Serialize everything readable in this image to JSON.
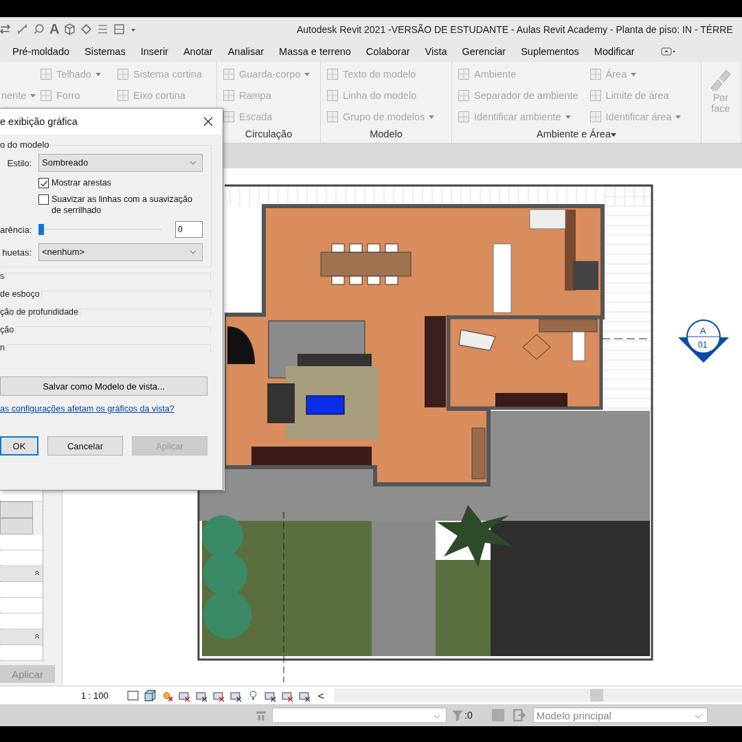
{
  "window": {
    "title": "Autodesk Revit 2021 -VERSÃO DE ESTUDANTE - Aulas Revit Academy - Planta de piso: IN - TÉRRE",
    "quick_access_letter": "A"
  },
  "tabs": [
    "Pré-moldado",
    "Sistemas",
    "Inserir",
    "Anotar",
    "Analisar",
    "Massa e terreno",
    "Colaborar",
    "Vista",
    "Gerenciar",
    "Suplementos",
    "Modificar"
  ],
  "ribbon": [
    {
      "columns": [
        [
          {
            "label": "nente",
            "kind": "cut",
            "dropdown": true
          }
        ],
        [
          {
            "label": "Telhado",
            "kind": "small",
            "dropdown": true
          },
          {
            "label": "Forro",
            "kind": "small",
            "dropdown": false
          }
        ],
        [
          {
            "label": "Sistema cortina",
            "kind": "small",
            "dropdown": false
          },
          {
            "label": "Eixo cortina",
            "kind": "small",
            "dropdown": false
          }
        ]
      ]
    },
    {
      "title": "Circulação",
      "title_dropdown": false,
      "columns": [
        [
          {
            "label": "Guarda-corpo",
            "kind": "small",
            "dropdown": true
          },
          {
            "label": "Rampa",
            "kind": "small",
            "dropdown": false
          },
          {
            "label": "Escada",
            "kind": "small",
            "dropdown": false
          }
        ]
      ]
    },
    {
      "title": "Modelo",
      "title_dropdown": false,
      "columns": [
        [
          {
            "label": "Texto do modelo",
            "kind": "small",
            "dropdown": false
          },
          {
            "label": "Linha do modelo",
            "kind": "small",
            "dropdown": false
          },
          {
            "label": "Grupo de modelos",
            "kind": "small",
            "dropdown": true
          }
        ]
      ]
    },
    {
      "title": "Ambiente e Área",
      "title_dropdown": true,
      "columns": [
        [
          {
            "label": "Ambiente",
            "kind": "small",
            "dropdown": false
          },
          {
            "label": "Separador de ambiente",
            "kind": "small",
            "dropdown": false
          },
          {
            "label": "Identificar ambiente",
            "kind": "small",
            "dropdown": true
          }
        ],
        [
          {
            "label": "Área",
            "kind": "small",
            "dropdown": true
          },
          {
            "label": "Limite de área",
            "kind": "small",
            "dropdown": false
          },
          {
            "label": "Identificar área",
            "kind": "small",
            "dropdown": true
          }
        ]
      ]
    },
    {
      "columns": [
        [
          {
            "label": "Por face",
            "kind": "large",
            "dropdown": false
          }
        ]
      ]
    }
  ],
  "dialog": {
    "title": "e exibição gráfica",
    "group_title": "o do modelo",
    "style": {
      "label": "Estilo:",
      "value": "Sombreado"
    },
    "checkboxes": [
      {
        "label": "Mostrar arestas",
        "checked": true
      },
      {
        "label": "Suavizar as linhas com a suavização de serrilhado",
        "checked": false
      }
    ],
    "transparency": {
      "label": "arência:",
      "level": 0,
      "value": "0"
    },
    "silhouettes": {
      "label": "huetas:",
      "value": "<nenhum>"
    },
    "sections": [
      "s",
      "de esboço",
      "ção de profundidade",
      "ção",
      "n"
    ],
    "save_button": "Salvar como Modelo de vista...",
    "help_link": "as configurações afetam os gráficos da vista?",
    "buttons": [
      {
        "label": "OK",
        "kind": "default",
        "disabled": false
      },
      {
        "label": "Cancelar",
        "kind": "normal",
        "disabled": false
      },
      {
        "label": "Aplicar",
        "kind": "normal",
        "disabled": true
      }
    ]
  },
  "properties": {
    "apply_button": "Aplicar",
    "apply_disabled": true
  },
  "elevation_marker": {
    "letter": "A",
    "number": "01"
  },
  "view_bar": {
    "scale": "1 : 100",
    "more": "<"
  },
  "status_bar": {
    "count": ":0",
    "model": "Modelo principal"
  }
}
